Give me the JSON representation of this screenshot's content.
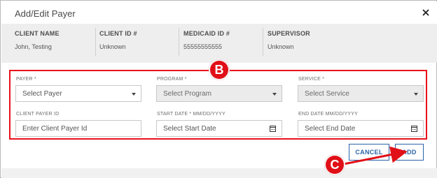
{
  "dialog": {
    "title": "Add/Edit Payer"
  },
  "info": {
    "columns": [
      {
        "label": "CLIENT NAME",
        "value": "John, Testing"
      },
      {
        "label": "CLIENT ID #",
        "value": "Unknown"
      },
      {
        "label": "MEDICAID ID #",
        "value": "55555555555"
      },
      {
        "label": "SUPERVISOR",
        "value": "Unknown"
      }
    ]
  },
  "form": {
    "payer": {
      "label": "PAYER *",
      "placeholder": "Select Payer"
    },
    "program": {
      "label": "PROGRAM *",
      "placeholder": "Select Program"
    },
    "service": {
      "label": "SERVICE *",
      "placeholder": "Select Service"
    },
    "client_payer_id": {
      "label": "CLIENT PAYER ID",
      "placeholder": "Enter Client Payer Id"
    },
    "start_date": {
      "label": "START DATE *",
      "format": "MM/DD/YYYY",
      "placeholder": "Select Start Date"
    },
    "end_date": {
      "label": "END DATE",
      "format": "MM/DD/YYYY",
      "placeholder": "Select End Date"
    }
  },
  "buttons": {
    "cancel": "CANCEL",
    "add": "ADD"
  },
  "callouts": {
    "b": "B",
    "c": "C"
  },
  "colors": {
    "annotation_red": "#e8111b",
    "button_blue": "#2c64a8"
  }
}
